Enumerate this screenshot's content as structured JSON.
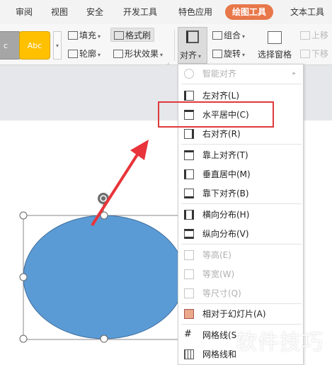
{
  "menubar": {
    "tabs": [
      "审阅",
      "视图",
      "安全",
      "开发工具",
      "特色应用",
      "绘图工具",
      "文本工具"
    ],
    "active_tab": "绘图工具",
    "accent_color": "#e8774a"
  },
  "ribbon": {
    "style_swatch_1": "c",
    "style_swatch_2": "Abc",
    "fill_label": "填充",
    "outline_label": "轮廓",
    "format_painter_label": "格式刷",
    "shape_effects_label": "形状效果",
    "align_label": "对齐",
    "group_label": "组合",
    "rotate_label": "旋转",
    "selection_pane_label": "选择窗格",
    "bring_forward_label": "上移",
    "send_backward_label": "下移"
  },
  "align_menu": {
    "items": [
      {
        "label": "智能对齐",
        "icon": "smart-align-icon",
        "disabled": true,
        "submenu": true
      },
      {
        "label": "左对齐(L)",
        "icon": "align-left-icon"
      },
      {
        "label": "水平居中(C)",
        "icon": "align-center-icon"
      },
      {
        "label": "右对齐(R)",
        "icon": "align-right-icon"
      },
      {
        "label": "靠上对齐(T)",
        "icon": "align-top-icon"
      },
      {
        "label": "垂直居中(M)",
        "icon": "align-middle-icon"
      },
      {
        "label": "靠下对齐(B)",
        "icon": "align-bottom-icon"
      },
      {
        "label": "横向分布(H)",
        "icon": "distribute-horizontal-icon"
      },
      {
        "label": "纵向分布(V)",
        "icon": "distribute-vertical-icon"
      },
      {
        "label": "等高(E)",
        "icon": "same-height-icon",
        "disabled": true
      },
      {
        "label": "等宽(W)",
        "icon": "same-width-icon",
        "disabled": true
      },
      {
        "label": "等尺寸(Q)",
        "icon": "same-size-icon",
        "disabled": true
      },
      {
        "label": "相对于幻灯片(A)",
        "icon": "relative-to-slide-icon"
      },
      {
        "label": "网格线(S",
        "icon": "gridlines-icon"
      },
      {
        "label": "网格线和",
        "icon": "grid-settings-icon"
      }
    ],
    "highlighted": "水平居中(C)"
  },
  "colors": {
    "ellipse_fill": "#5b9bd5",
    "arrow": "#e8343a",
    "highlight_box": "#e0393c"
  },
  "watermark": "软件技巧"
}
